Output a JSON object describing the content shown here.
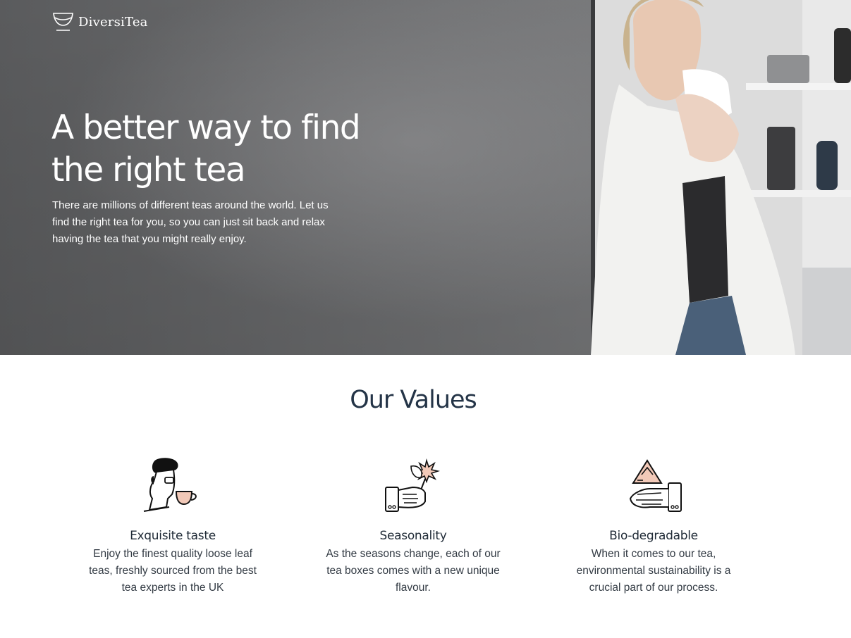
{
  "brand": {
    "name": "DiversiTea"
  },
  "hero": {
    "title": "A better way to find the right tea",
    "subtitle": "There are millions of different teas around the world. Let us find the right tea for you, so you can just sit back and relax having the tea that you might really enjoy."
  },
  "values": {
    "heading": "Our Values",
    "items": [
      {
        "icon": "tea-drinker-icon",
        "title": "Exquisite taste",
        "description": "Enjoy the finest quality loose leaf teas, freshly sourced from the best tea experts in the UK"
      },
      {
        "icon": "hand-leaf-icon",
        "title": "Seasonality",
        "description": "As the seasons change, each of our tea boxes comes with a new unique flavour."
      },
      {
        "icon": "hand-recycle-icon",
        "title": "Bio-degradable",
        "description": "When it comes to our tea, environmental sustainability is a crucial part of our process."
      }
    ]
  },
  "colors": {
    "heading": "#243447",
    "accent_pink": "#f2c9b8",
    "hero_overlay": "#6e6f71"
  }
}
